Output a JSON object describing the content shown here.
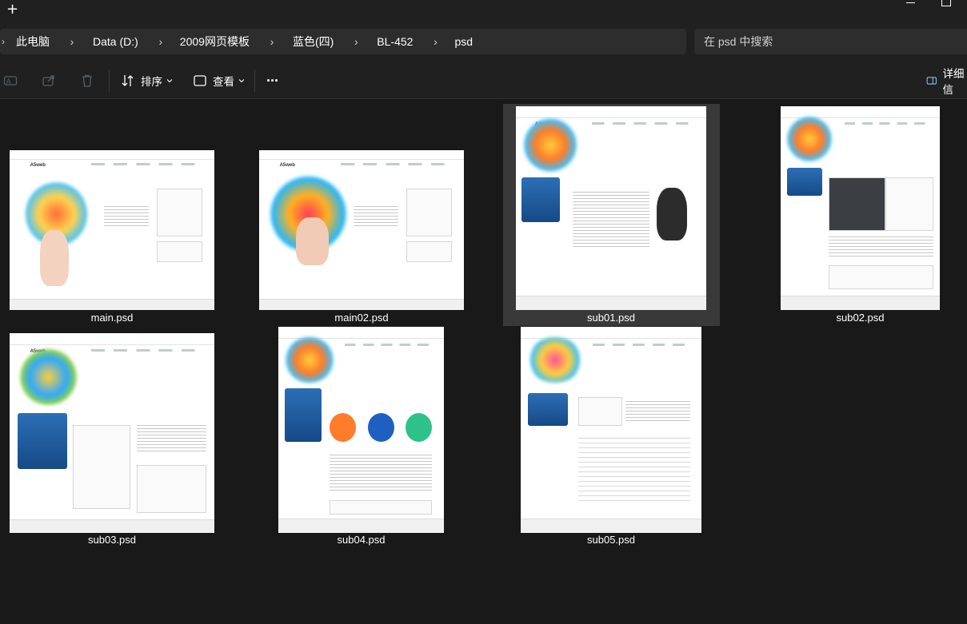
{
  "titlebar": {
    "new_tab_label": "+"
  },
  "breadcrumb": {
    "items": [
      "此电脑",
      "Data (D:)",
      "2009网页模板",
      "蓝色(四)",
      "BL-452",
      "psd"
    ]
  },
  "search": {
    "placeholder": "在 psd 中搜索"
  },
  "commandbar": {
    "sort_label": "排序",
    "view_label": "查看",
    "more_label": "···",
    "details_label": "详细信"
  },
  "files": [
    {
      "name": "main.psd",
      "selected": false
    },
    {
      "name": "main02.psd",
      "selected": false
    },
    {
      "name": "sub01.psd",
      "selected": true
    },
    {
      "name": "sub02.psd",
      "selected": false
    },
    {
      "name": "sub03.psd",
      "selected": false
    },
    {
      "name": "sub04.psd",
      "selected": false
    },
    {
      "name": "sub05.psd",
      "selected": false
    }
  ],
  "colors": {
    "background": "#191919",
    "chrome": "#202020",
    "field": "#2d2d2d",
    "selection": "#393939"
  }
}
